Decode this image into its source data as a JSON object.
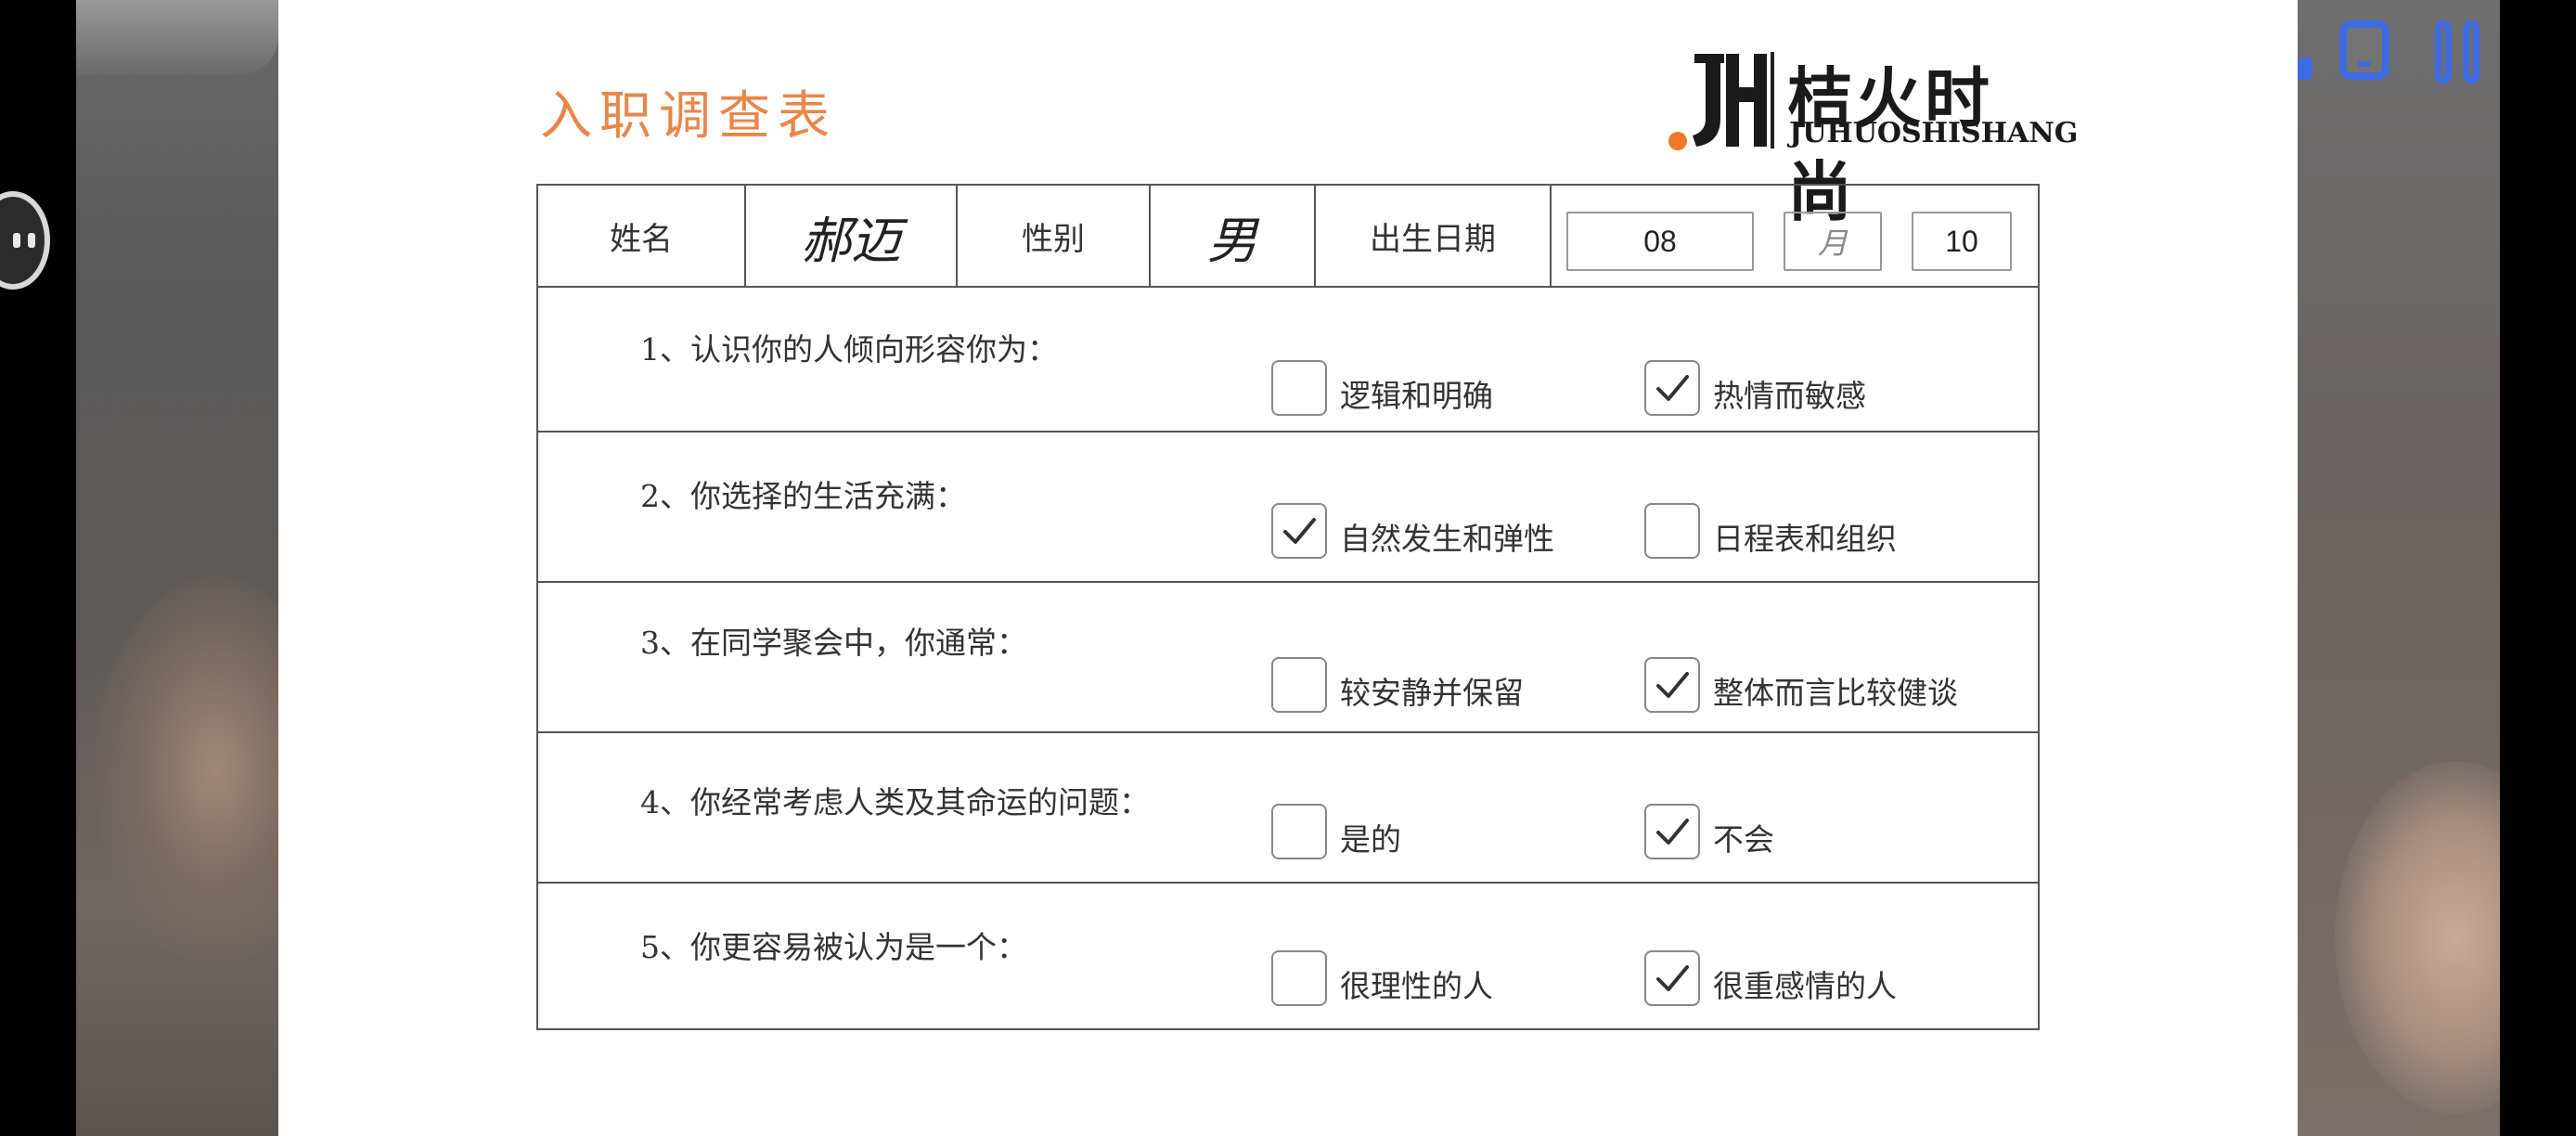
{
  "form": {
    "title": "入职调查表",
    "logo": {
      "cn": "桔火时尚",
      "en": "JUHUOSHISHANG"
    },
    "header": {
      "name_label": "姓名",
      "name_value": "郝迈",
      "gender_label": "性别",
      "gender_value": "男",
      "birth_label": "出生日期",
      "birth_month": "08",
      "birth_month_unit": "月",
      "birth_day": "10"
    },
    "questions": [
      {
        "text": "1、认识你的人倾向形容你为：",
        "options": [
          {
            "label": "逻辑和明确",
            "checked": false
          },
          {
            "label": "热情而敏感",
            "checked": true
          }
        ]
      },
      {
        "text": "2、你选择的生活充满：",
        "options": [
          {
            "label": "自然发生和弹性",
            "checked": true
          },
          {
            "label": "日程表和组织",
            "checked": false
          }
        ]
      },
      {
        "text": "3、在同学聚会中，你通常：",
        "options": [
          {
            "label": "较安静并保留",
            "checked": false
          },
          {
            "label": "整体而言比较健谈",
            "checked": true
          }
        ]
      },
      {
        "text": "4、你经常考虑人类及其命运的问题：",
        "options": [
          {
            "label": "是的",
            "checked": false
          },
          {
            "label": "不会",
            "checked": true
          }
        ]
      },
      {
        "text": "5、你更容易被认为是一个：",
        "options": [
          {
            "label": "很理性的人",
            "checked": false
          },
          {
            "label": "很重感情的人",
            "checked": true
          }
        ]
      }
    ]
  },
  "colors": {
    "title": "#e8874a",
    "logo_dot": "#f07a2a",
    "player_icons": "#3e6be0"
  },
  "player": {
    "icons": [
      "chat-bubble-icon",
      "tablet-icon",
      "pause-icon"
    ]
  }
}
